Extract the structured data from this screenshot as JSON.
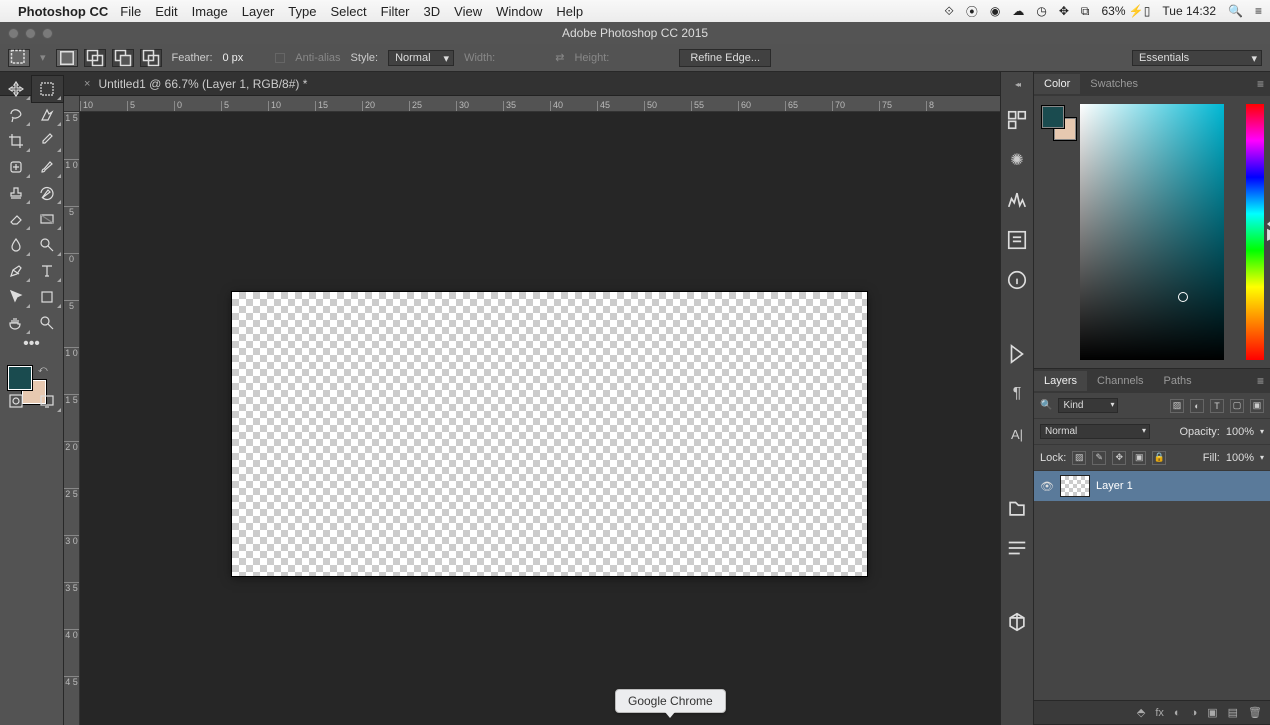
{
  "menubar": {
    "apple": "",
    "app": "Photoshop CC",
    "items": [
      "File",
      "Edit",
      "Image",
      "Layer",
      "Type",
      "Select",
      "Filter",
      "3D",
      "View",
      "Window",
      "Help"
    ],
    "battery": "63%",
    "clock": "Tue 14:32"
  },
  "window": {
    "title": "Adobe Photoshop CC 2015"
  },
  "options": {
    "feather_label": "Feather:",
    "feather_value": "0 px",
    "antialias": "Anti-alias",
    "style_label": "Style:",
    "style_value": "Normal",
    "width_label": "Width:",
    "height_label": "Height:",
    "refine": "Refine Edge...",
    "workspace": "Essentials"
  },
  "document": {
    "tab": "Untitled1 @ 66.7% (Layer 1, RGB/8#) *"
  },
  "ruler_h": [
    "10",
    "5",
    "0",
    "5",
    "10",
    "15",
    "20",
    "25",
    "30",
    "35",
    "40",
    "45",
    "50",
    "55",
    "60",
    "65",
    "70",
    "75",
    "8"
  ],
  "ruler_v": [
    "1 5",
    "1 0",
    "5",
    "0",
    "5",
    "1 0",
    "1 5",
    "2 0",
    "2 5",
    "3 0",
    "3 5",
    "4 0",
    "4 5"
  ],
  "color_panel": {
    "tabs": [
      "Color",
      "Swatches"
    ]
  },
  "layers_panel": {
    "tabs": [
      "Layers",
      "Channels",
      "Paths"
    ],
    "kind": "Kind",
    "blend": "Normal",
    "opacity_label": "Opacity:",
    "opacity_value": "100%",
    "lock_label": "Lock:",
    "fill_label": "Fill:",
    "fill_value": "100%",
    "layer1": "Layer 1"
  },
  "tooltip": "Google Chrome",
  "colors": {
    "fg": "#1a4b4f",
    "bg": "#e6c8b0"
  }
}
